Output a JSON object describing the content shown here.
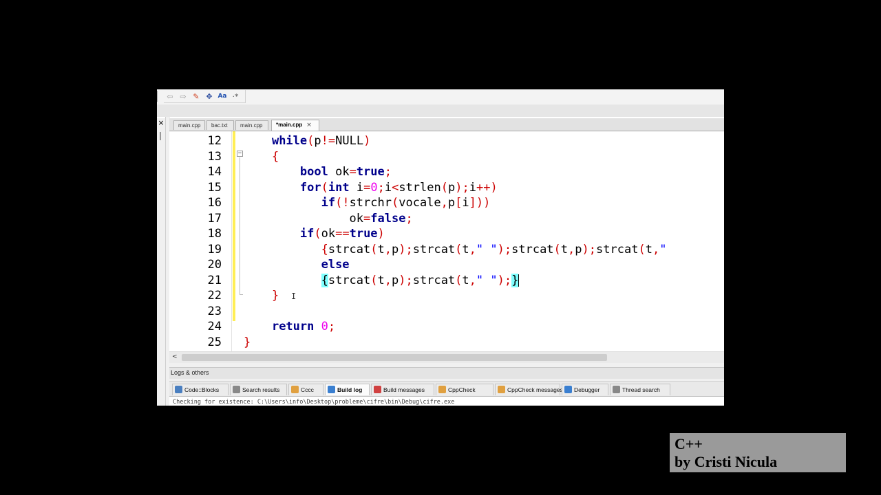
{
  "colors": {
    "keyword": "#00008b",
    "operator": "#cc0000",
    "number": "#ee00ee",
    "string": "#0000ff",
    "brace_match": "#7fffff",
    "change_bar": "#ffee55"
  },
  "toolbar": {
    "icons": [
      "arrow-left-icon",
      "arrow-right-icon",
      "highlight-icon",
      "select-icon",
      "text-format-icon",
      "jump-icon"
    ],
    "glyphs": [
      "⇦",
      "⇨",
      "✎",
      "✥",
      "Aa",
      "·*"
    ]
  },
  "side_panel": {
    "close": "×"
  },
  "tabs": [
    {
      "label": "main.cpp",
      "active": false
    },
    {
      "label": "bac.txt",
      "active": false
    },
    {
      "label": "main.cpp",
      "active": false
    },
    {
      "label": "*main.cpp",
      "active": true,
      "close": "×"
    }
  ],
  "editor": {
    "line_numbers": [
      "12",
      "13",
      "14",
      "15",
      "16",
      "17",
      "18",
      "19",
      "20",
      "21",
      "22",
      "23",
      "24",
      "25"
    ],
    "fold_glyph": "−",
    "ibeam": "I"
  },
  "code_lines": [
    {
      "indent": "    ",
      "tokens": [
        {
          "t": "while",
          "c": "kw"
        },
        {
          "t": "(",
          "c": "op"
        },
        {
          "t": "p",
          "c": ""
        },
        {
          "t": "!=",
          "c": "op"
        },
        {
          "t": "NULL",
          "c": ""
        },
        {
          "t": ")",
          "c": "op"
        }
      ]
    },
    {
      "indent": "    ",
      "tokens": [
        {
          "t": "{",
          "c": "op"
        }
      ]
    },
    {
      "indent": "        ",
      "tokens": [
        {
          "t": "bool",
          "c": "kw"
        },
        {
          "t": " ok",
          "c": ""
        },
        {
          "t": "=",
          "c": "op"
        },
        {
          "t": "true",
          "c": "kw"
        },
        {
          "t": ";",
          "c": "op"
        }
      ]
    },
    {
      "indent": "        ",
      "tokens": [
        {
          "t": "for",
          "c": "kw"
        },
        {
          "t": "(",
          "c": "op"
        },
        {
          "t": "int",
          "c": "kw"
        },
        {
          "t": " i",
          "c": ""
        },
        {
          "t": "=",
          "c": "op"
        },
        {
          "t": "0",
          "c": "num"
        },
        {
          "t": ";",
          "c": "op"
        },
        {
          "t": "i",
          "c": ""
        },
        {
          "t": "<",
          "c": "op"
        },
        {
          "t": "strlen",
          "c": ""
        },
        {
          "t": "(",
          "c": "op"
        },
        {
          "t": "p",
          "c": ""
        },
        {
          "t": ");",
          "c": "op"
        },
        {
          "t": "i",
          "c": ""
        },
        {
          "t": "++)",
          "c": "op"
        }
      ]
    },
    {
      "indent": "           ",
      "tokens": [
        {
          "t": "if",
          "c": "kw"
        },
        {
          "t": "(!",
          "c": "op"
        },
        {
          "t": "strchr",
          "c": ""
        },
        {
          "t": "(",
          "c": "op"
        },
        {
          "t": "vocale",
          "c": ""
        },
        {
          "t": ",",
          "c": "op"
        },
        {
          "t": "p",
          "c": ""
        },
        {
          "t": "[",
          "c": "op"
        },
        {
          "t": "i",
          "c": ""
        },
        {
          "t": "]))",
          "c": "op"
        }
      ]
    },
    {
      "indent": "               ",
      "tokens": [
        {
          "t": "ok",
          "c": ""
        },
        {
          "t": "=",
          "c": "op"
        },
        {
          "t": "false",
          "c": "kw"
        },
        {
          "t": ";",
          "c": "op"
        }
      ]
    },
    {
      "indent": "        ",
      "tokens": [
        {
          "t": "if",
          "c": "kw"
        },
        {
          "t": "(",
          "c": "op"
        },
        {
          "t": "ok",
          "c": ""
        },
        {
          "t": "==",
          "c": "op"
        },
        {
          "t": "true",
          "c": "kw"
        },
        {
          "t": ")",
          "c": "op"
        }
      ]
    },
    {
      "indent": "           ",
      "tokens": [
        {
          "t": "{",
          "c": "op"
        },
        {
          "t": "strcat",
          "c": ""
        },
        {
          "t": "(",
          "c": "op"
        },
        {
          "t": "t",
          "c": ""
        },
        {
          "t": ",",
          "c": "op"
        },
        {
          "t": "p",
          "c": ""
        },
        {
          "t": ");",
          "c": "op"
        },
        {
          "t": "strcat",
          "c": ""
        },
        {
          "t": "(",
          "c": "op"
        },
        {
          "t": "t",
          "c": ""
        },
        {
          "t": ",",
          "c": "op"
        },
        {
          "t": "\" \"",
          "c": "str"
        },
        {
          "t": ");",
          "c": "op"
        },
        {
          "t": "strcat",
          "c": ""
        },
        {
          "t": "(",
          "c": "op"
        },
        {
          "t": "t",
          "c": ""
        },
        {
          "t": ",",
          "c": "op"
        },
        {
          "t": "p",
          "c": ""
        },
        {
          "t": ");",
          "c": "op"
        },
        {
          "t": "strcat",
          "c": ""
        },
        {
          "t": "(",
          "c": "op"
        },
        {
          "t": "t",
          "c": ""
        },
        {
          "t": ",",
          "c": "op"
        },
        {
          "t": "\"",
          "c": "str"
        }
      ]
    },
    {
      "indent": "           ",
      "tokens": [
        {
          "t": "else",
          "c": "kw"
        }
      ]
    },
    {
      "indent": "           ",
      "tokens": [
        {
          "t": "{",
          "c": "hl"
        },
        {
          "t": "strcat",
          "c": ""
        },
        {
          "t": "(",
          "c": "op"
        },
        {
          "t": "t",
          "c": ""
        },
        {
          "t": ",",
          "c": "op"
        },
        {
          "t": "p",
          "c": ""
        },
        {
          "t": ");",
          "c": "op"
        },
        {
          "t": "strcat",
          "c": ""
        },
        {
          "t": "(",
          "c": "op"
        },
        {
          "t": "t",
          "c": ""
        },
        {
          "t": ",",
          "c": "op"
        },
        {
          "t": "\" \"",
          "c": "str"
        },
        {
          "t": ");",
          "c": "op"
        },
        {
          "t": "}",
          "c": "hl"
        }
      ],
      "caret": true
    },
    {
      "indent": "    ",
      "tokens": [
        {
          "t": "}",
          "c": "op"
        }
      ]
    },
    {
      "indent": "",
      "tokens": []
    },
    {
      "indent": "    ",
      "tokens": [
        {
          "t": "return",
          "c": "kw"
        },
        {
          "t": " ",
          "c": ""
        },
        {
          "t": "0",
          "c": "num"
        },
        {
          "t": ";",
          "c": "op"
        }
      ]
    },
    {
      "indent": "",
      "tokens": [
        {
          "t": "}",
          "c": "op"
        }
      ]
    }
  ],
  "scrollbar": {
    "left_arrow": "<"
  },
  "logs": {
    "title": "Logs & others",
    "tabs": [
      {
        "label": "Code::Blocks",
        "icon": "codeblocks-icon",
        "color": "#4a7fc0",
        "active": false
      },
      {
        "label": "Search results",
        "icon": "search-icon",
        "color": "#888888",
        "active": false
      },
      {
        "label": "Cccc",
        "icon": "pencil-icon",
        "color": "#e0a040",
        "active": false
      },
      {
        "label": "Build log",
        "icon": "gear-icon",
        "color": "#3a7fd0",
        "active": true
      },
      {
        "label": "Build messages",
        "icon": "pin-icon",
        "color": "#d04040",
        "active": false
      },
      {
        "label": "CppCheck",
        "icon": "pencil-icon",
        "color": "#e0a040",
        "active": false
      },
      {
        "label": "CppCheck messages",
        "icon": "pencil-icon",
        "color": "#e0a040",
        "active": false
      },
      {
        "label": "Debugger",
        "icon": "gear-icon",
        "color": "#3a7fd0",
        "active": false
      },
      {
        "label": "Thread search",
        "icon": "search-icon",
        "color": "#888888",
        "active": false
      }
    ],
    "content": "Checking for existence: C:\\Users\\info\\Desktop\\probleme\\cifre\\bin\\Debug\\cifre.exe"
  },
  "watermark": {
    "line1": "C++",
    "line2": "by Cristi Nicula"
  }
}
